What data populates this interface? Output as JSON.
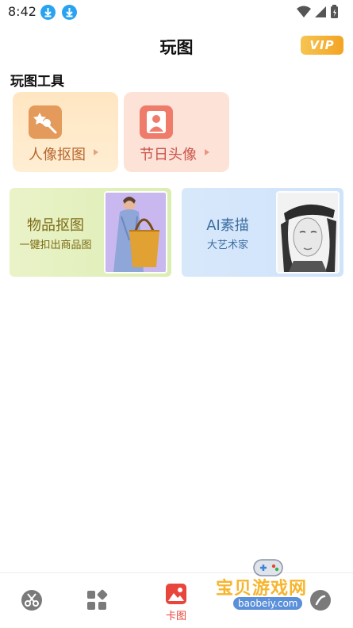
{
  "status_bar": {
    "time": "8:42"
  },
  "header": {
    "title": "玩图",
    "vip": "VIP"
  },
  "section": {
    "title": "玩图工具"
  },
  "tools": [
    {
      "label": "人像抠图",
      "icon": "magic-wand-icon"
    },
    {
      "label": "节日头像",
      "icon": "portrait-icon"
    }
  ],
  "features": [
    {
      "title": "物品抠图",
      "subtitle": "一键扣出商品图"
    },
    {
      "title": "AI素描",
      "subtitle": "大艺术家"
    }
  ],
  "bottom_nav": {
    "active_label": "卡图"
  },
  "watermark": {
    "text": "宝贝游戏网",
    "url": "baobeiy.com"
  },
  "colors": {
    "accent": "#e8453c",
    "vip": "#f3a423",
    "download": "#29a3f0"
  }
}
